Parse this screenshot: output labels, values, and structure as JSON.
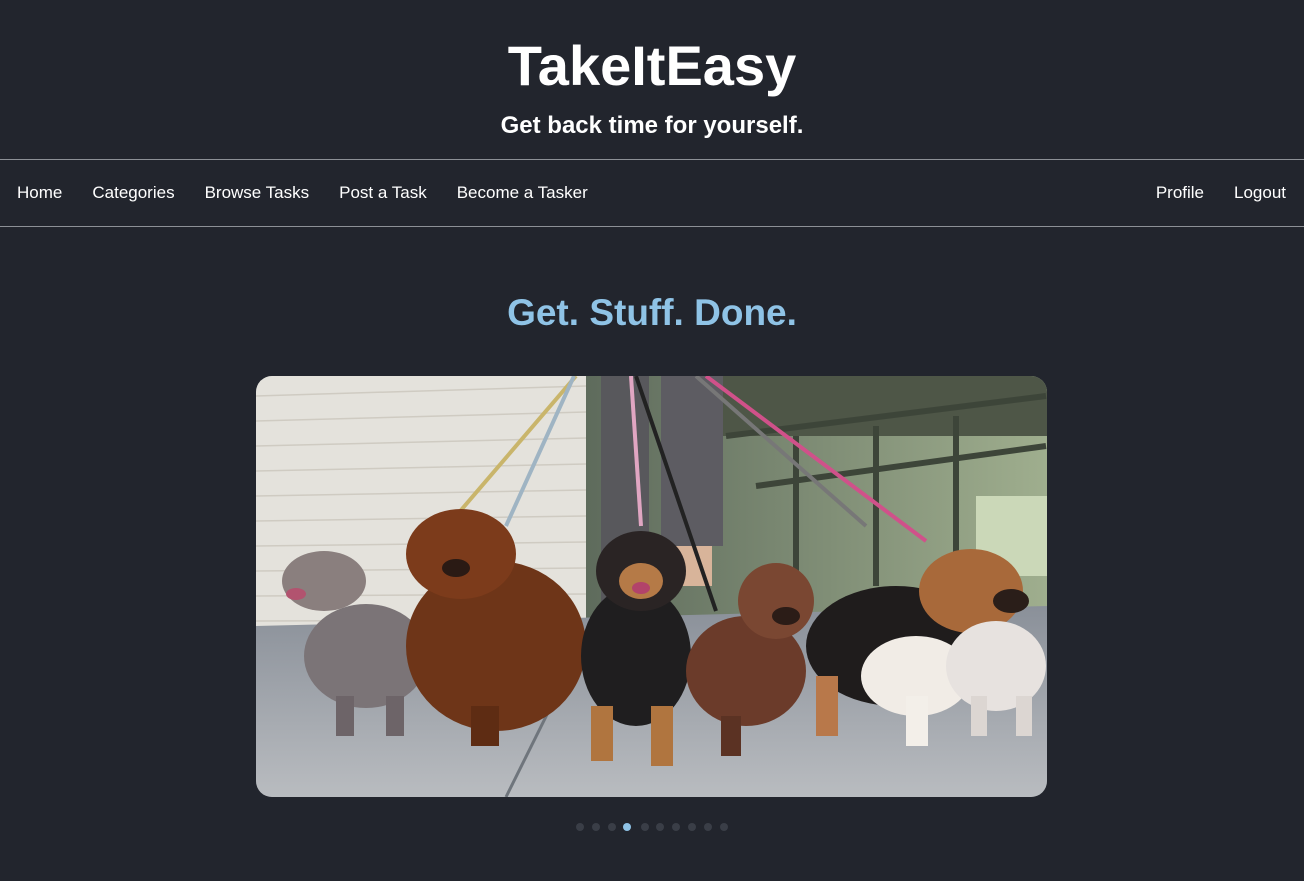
{
  "header": {
    "title": "TakeItEasy",
    "tagline": "Get back time for yourself."
  },
  "nav": {
    "left": [
      {
        "label": "Home"
      },
      {
        "label": "Categories"
      },
      {
        "label": "Browse Tasks"
      },
      {
        "label": "Post a Task"
      },
      {
        "label": "Become a Tasker"
      }
    ],
    "right": [
      {
        "label": "Profile"
      },
      {
        "label": "Logout"
      }
    ]
  },
  "hero": {
    "heading": "Get. Stuff. Done."
  },
  "carousel": {
    "slide_count": 10,
    "active_index": 3,
    "image_subject": "dogs-on-leashes-photo"
  },
  "colors": {
    "background": "#22252d",
    "accent": "#8fc3e6",
    "nav_border": "#8d9096",
    "dot_inactive": "#3a3e47"
  }
}
